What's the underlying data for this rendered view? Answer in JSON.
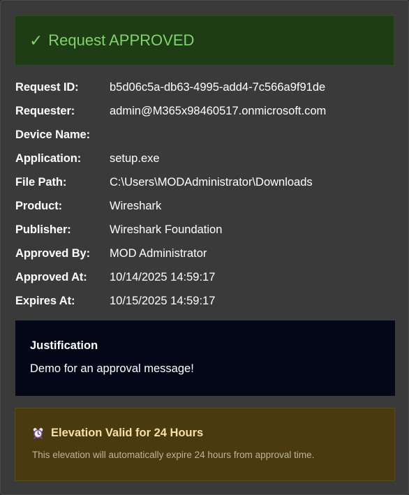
{
  "banner": {
    "check_glyph": "✓",
    "title": "Request APPROVED",
    "icon": "checkmark-icon",
    "color": "#7fd46b"
  },
  "details": [
    {
      "key": "request-id",
      "label": "Request ID:",
      "value": "b5d06c5a-db63-4995-add4-7c566a9f91de"
    },
    {
      "key": "requester",
      "label": "Requester:",
      "value": "admin@M365x98460517.onmicrosoft.com"
    },
    {
      "key": "device-name",
      "label": "Device Name:",
      "value": ""
    },
    {
      "key": "application",
      "label": "Application:",
      "value": "setup.exe"
    },
    {
      "key": "file-path",
      "label": "File Path:",
      "value": "C:\\Users\\MODAdministrator\\Downloads"
    },
    {
      "key": "product",
      "label": "Product:",
      "value": "Wireshark"
    },
    {
      "key": "publisher",
      "label": "Publisher:",
      "value": "Wireshark Foundation"
    },
    {
      "key": "approved-by",
      "label": "Approved By:",
      "value": "MOD Administrator"
    },
    {
      "key": "approved-at",
      "label": "Approved At:",
      "value": "10/14/2025 14:59:17"
    },
    {
      "key": "expires-at",
      "label": "Expires At:",
      "value": "10/15/2025 14:59:17"
    }
  ],
  "justification": {
    "title": "Justification",
    "text": "Demo for an approval message!"
  },
  "elevation": {
    "icon": "alarm-clock-icon",
    "title": "Elevation Valid for 24 Hours",
    "text": "This elevation will automatically expire 24 hours from approval time."
  },
  "colors": {
    "card_background": "#3a3a3a",
    "approved_banner": "#1f3d14",
    "justification_background": "#030718",
    "elevation_background": "#4a3a10",
    "elevation_title": "#f6e0a3"
  }
}
